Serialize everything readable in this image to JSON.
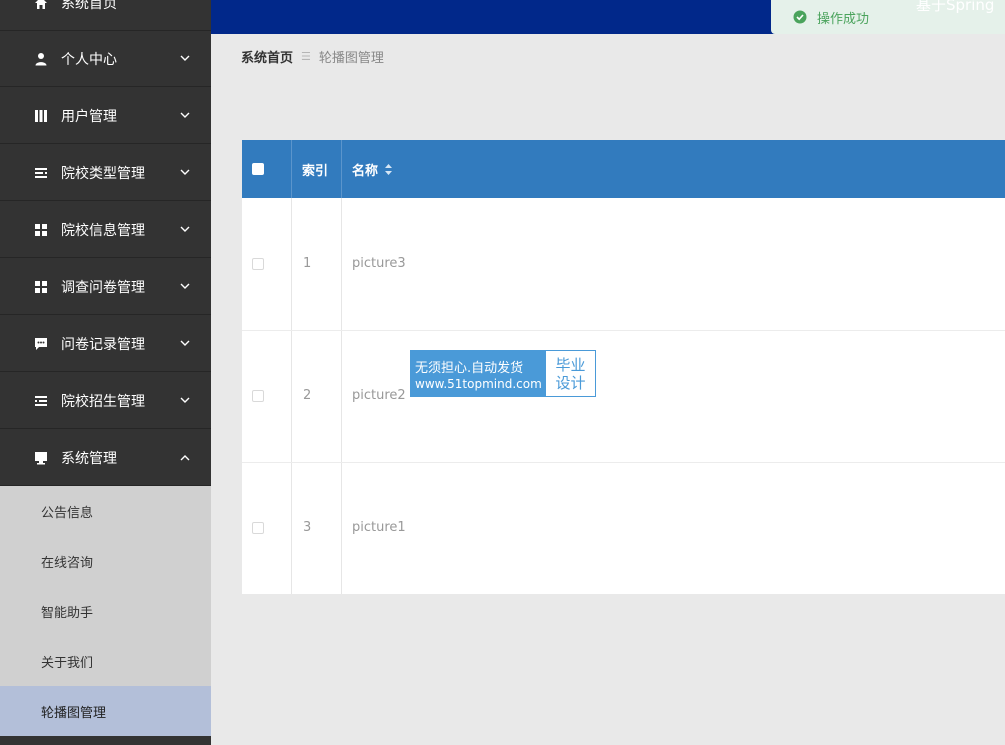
{
  "sidebar": {
    "items": [
      {
        "label": "系统首页",
        "icon": "home-icon"
      },
      {
        "label": "个人中心",
        "icon": "user-icon"
      },
      {
        "label": "用户管理",
        "icon": "book-icon"
      },
      {
        "label": "院校类型管理",
        "icon": "list-icon"
      },
      {
        "label": "院校信息管理",
        "icon": "grid-icon"
      },
      {
        "label": "调查问卷管理",
        "icon": "grid-icon"
      },
      {
        "label": "问卷记录管理",
        "icon": "chat-icon"
      },
      {
        "label": "院校招生管理",
        "icon": "list-icon"
      },
      {
        "label": "系统管理",
        "icon": "monitor-icon"
      }
    ],
    "submenu": [
      {
        "label": "公告信息"
      },
      {
        "label": "在线咨询"
      },
      {
        "label": "智能助手"
      },
      {
        "label": "关于我们"
      },
      {
        "label": "轮播图管理",
        "active": true
      }
    ]
  },
  "topbar": {
    "toast": "操作成功",
    "site_title": "基于Spring"
  },
  "breadcrumb": {
    "home": "系统首页",
    "current": "轮播图管理"
  },
  "table": {
    "columns": [
      "索引",
      "名称"
    ],
    "rows": [
      {
        "index": "1",
        "name": "picture3"
      },
      {
        "index": "2",
        "name": "picture2"
      },
      {
        "index": "3",
        "name": "picture1"
      }
    ]
  },
  "watermark": {
    "line1": "无须担心.自动发货",
    "line2": "www.51topmind.com",
    "right1": "毕业",
    "right2": "设计"
  },
  "colors": {
    "sidebar_bg": "#333333",
    "topbar_bg": "#01288a",
    "table_header_bg": "#327bbe",
    "submenu_active_bg": "#b3bfd9",
    "toast_text": "#4aa35c"
  }
}
